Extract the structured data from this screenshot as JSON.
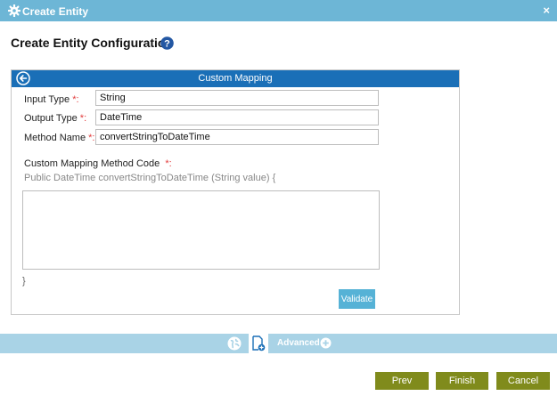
{
  "window": {
    "title": "Create Entity",
    "close_glyph": "×",
    "icon": "gear-icon"
  },
  "page": {
    "heading": "Create Entity Configuration",
    "help_icon": "help-icon"
  },
  "panel": {
    "title": "Custom Mapping",
    "back_icon": "back-arrow-icon",
    "fields": {
      "input_type": {
        "label": "Input Type",
        "required": "*:",
        "value": "String"
      },
      "output_type": {
        "label": "Output Type",
        "required": "*:",
        "value": "DateTime"
      },
      "method_name": {
        "label": "Method Name",
        "required": "*:",
        "value": "convertStringToDateTime"
      }
    },
    "code": {
      "label": "Custom Mapping Method Code",
      "required": "*:",
      "signature": "Public DateTime convertStringToDateTime (String value) {",
      "body": "",
      "closing": "}"
    },
    "validate_label": "Validate"
  },
  "toolbar": {
    "advanced_label": "Advanced",
    "globe_icon": "globe-icon",
    "doc_icon": "document-add-icon",
    "plus_icon": "plus-circle-icon"
  },
  "footer": {
    "prev_label": "Prev",
    "finish_label": "Finish",
    "cancel_label": "Cancel"
  },
  "colors": {
    "titlebar": "#6db6d6",
    "panel_header": "#1a6fb7",
    "toolbar": "#a9d3e6",
    "button": "#808b1c",
    "validate": "#56b2d6",
    "required": "#e23b3b"
  }
}
